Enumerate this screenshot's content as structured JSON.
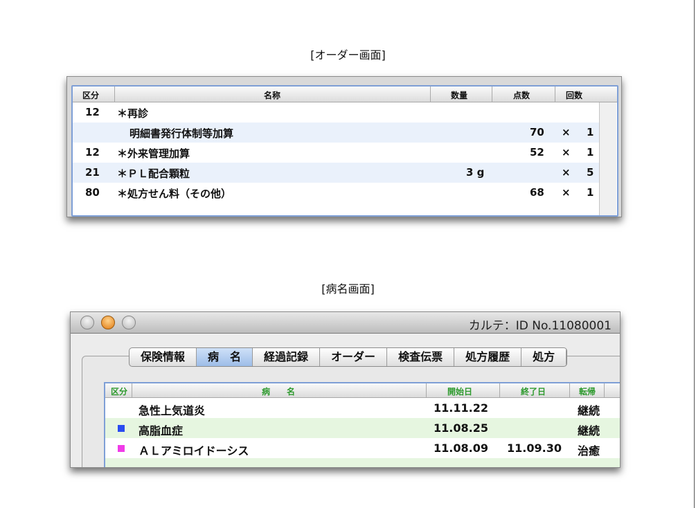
{
  "order_section": {
    "caption": "[オーダー画面]",
    "columns": {
      "kubun": "区分",
      "name": "名称",
      "quantity": "数量",
      "points": "点数",
      "times": "回数"
    },
    "rows": [
      {
        "kubun": "12",
        "name": "＊再診",
        "quantity": "",
        "points": "",
        "x": "",
        "times": ""
      },
      {
        "kubun": "",
        "name": "明細書発行体制等加算",
        "quantity": "",
        "points": "70",
        "x": "×",
        "times": "1"
      },
      {
        "kubun": "12",
        "name": "＊外来管理加算",
        "quantity": "",
        "points": "52",
        "x": "×",
        "times": "1"
      },
      {
        "kubun": "21",
        "name": "＊ＰＬ配合顆粒",
        "quantity": "3 g",
        "points": "",
        "x": "×",
        "times": "5"
      },
      {
        "kubun": "80",
        "name": "＊処方せん料（その他）",
        "quantity": "",
        "points": "68",
        "x": "×",
        "times": "1"
      }
    ]
  },
  "disease_section": {
    "caption": "[病名画面]",
    "window_title": "カルテ：ID No.11080001",
    "tabs": [
      "保険情報",
      "病　名",
      "経過記録",
      "オーダー",
      "検査伝票",
      "処方履歴",
      "処方"
    ],
    "active_tab": "病　名",
    "columns": {
      "kubun": "区分",
      "name": "病　　名",
      "start": "開始日",
      "end": "終了日",
      "outcome": "転帰"
    },
    "rows": [
      {
        "marker_color": "",
        "name": "急性上気道炎",
        "start": "11.11.22",
        "end": "",
        "outcome": "継続"
      },
      {
        "marker_color": "#2a4cf0",
        "name": "高脂血症",
        "start": "11.08.25",
        "end": "",
        "outcome": "継続"
      },
      {
        "marker_color": "#f03ce8",
        "name": "ＡＬアミロイドーシス",
        "start": "11.08.09",
        "end": "11.09.30",
        "outcome": "治癒"
      }
    ]
  }
}
